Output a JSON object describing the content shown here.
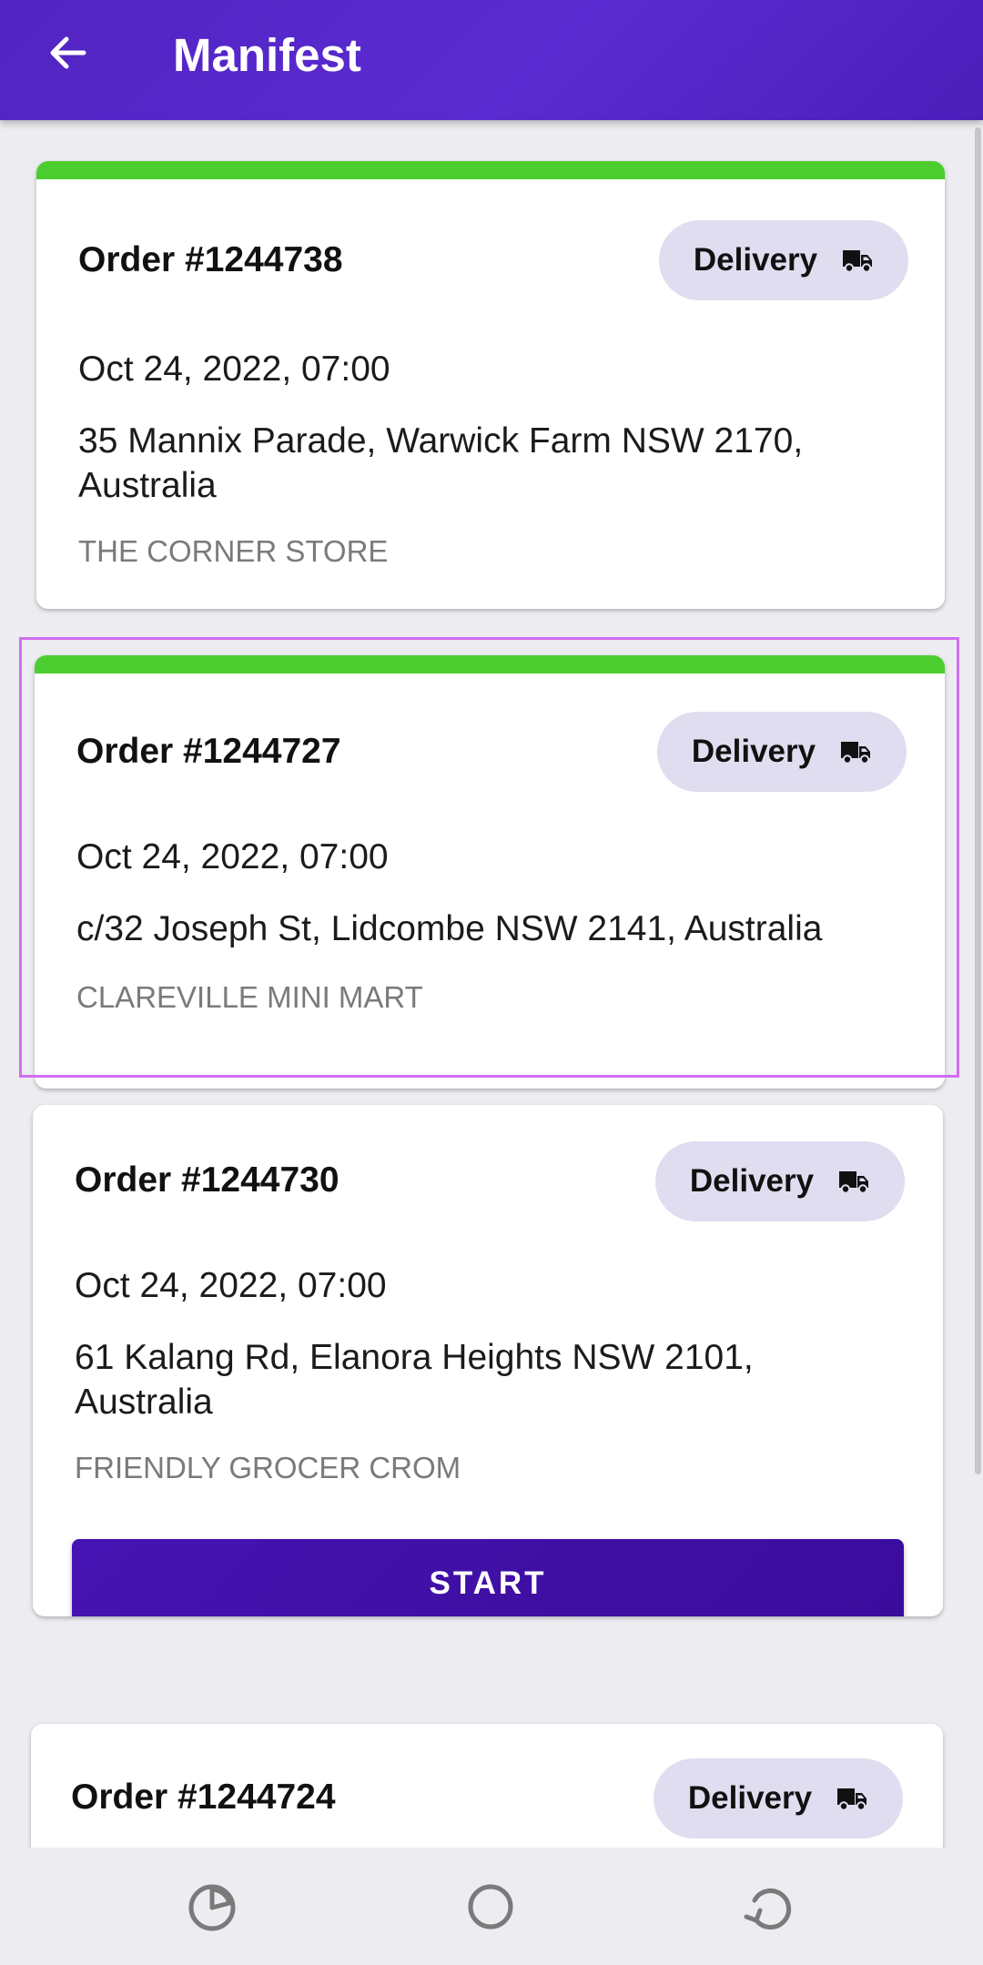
{
  "app_bar": {
    "title": "Manifest",
    "back_icon": "arrow-left-icon",
    "background_color": "#5326c4"
  },
  "orders": [
    {
      "order_no": "Order #1244738",
      "type_label": "Delivery",
      "type_icon": "truck-icon",
      "date": "Oct 24, 2022, 07:00",
      "address": "35 Mannix Parade, Warwick Farm NSW 2170, Australia",
      "store": "THE CORNER STORE",
      "status_color": "#4ccd2f"
    },
    {
      "order_no": "Order #1244727",
      "type_label": "Delivery",
      "type_icon": "truck-icon",
      "date": "Oct 24, 2022, 07:00",
      "address": "c/32 Joseph St, Lidcombe NSW 2141, Australia",
      "store": "CLAREVILLE MINI MART",
      "status_color": "#4ccd2f",
      "selected": true
    },
    {
      "order_no": "Order #1244730",
      "type_label": "Delivery",
      "type_icon": "truck-icon",
      "date": "Oct 24, 2022, 07:00",
      "address": "61 Kalang Rd, Elanora Heights NSW 2101, Australia",
      "store": "FRIENDLY GROCER CROM",
      "action_label": "START"
    },
    {
      "order_no": "Order #1244724",
      "type_label": "Delivery",
      "type_icon": "truck-icon"
    }
  ],
  "nav_bar": {
    "recents_icon": "recents-icon",
    "home_icon": "home-circle-icon",
    "back_icon": "rotate-back-icon"
  },
  "colors": {
    "accent": "#4b1bb5",
    "chip_background": "#e1ddf0",
    "status_green": "#4ccd2f",
    "selection_outline": "#d06ef0",
    "background": "#ececf1"
  }
}
